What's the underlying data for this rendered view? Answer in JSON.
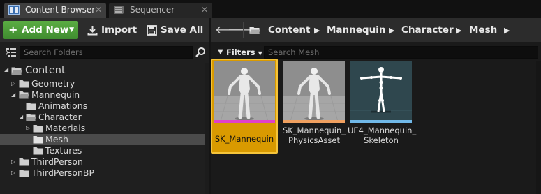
{
  "tabs": [
    {
      "label": "Content Browser",
      "icon": "content-browser-icon",
      "active": true
    },
    {
      "label": "Sequencer",
      "icon": "sequencer-icon",
      "active": false
    }
  ],
  "toolbar": {
    "add_new_label": "Add New",
    "import_label": "Import",
    "save_all_label": "Save All"
  },
  "breadcrumb": [
    "Content",
    "Mannequin",
    "Character",
    "Mesh"
  ],
  "folder_search": {
    "placeholder": "Search Folders"
  },
  "asset_search": {
    "filters_label": "Filters",
    "placeholder": "Search Mesh"
  },
  "tree": [
    {
      "label": "Content",
      "depth": 0,
      "expanded": true
    },
    {
      "label": "Geometry",
      "depth": 1,
      "expanded": false
    },
    {
      "label": "Mannequin",
      "depth": 1,
      "expanded": true
    },
    {
      "label": "Animations",
      "depth": 2,
      "expanded": null
    },
    {
      "label": "Character",
      "depth": 2,
      "expanded": true
    },
    {
      "label": "Materials",
      "depth": 3,
      "expanded": false
    },
    {
      "label": "Mesh",
      "depth": 3,
      "expanded": null,
      "selected": true
    },
    {
      "label": "Textures",
      "depth": 3,
      "expanded": null
    },
    {
      "label": "ThirdPerson",
      "depth": 1,
      "expanded": false
    },
    {
      "label": "ThirdPersonBP",
      "depth": 1,
      "expanded": false
    }
  ],
  "assets": [
    {
      "name": "SK_Mannequin",
      "name_lines": [
        "SK_Mannequin"
      ],
      "type_color": "#e040c8",
      "selected": true
    },
    {
      "name": "SK_Mannequin_PhysicsAsset",
      "name_lines": [
        "SK_Mannequin_",
        "PhysicsAsset"
      ],
      "type_color": "#f0a060",
      "selected": false
    },
    {
      "name": "UE4_Mannequin_Skeleton",
      "name_lines": [
        "UE4_Mannequin_",
        "Skeleton"
      ],
      "type_color": "#70b8e8",
      "selected": false
    }
  ],
  "colors": {
    "accent_green": "#4fa03a",
    "selection_orange": "#d99a00",
    "panel_bg": "#1f1f1f"
  }
}
